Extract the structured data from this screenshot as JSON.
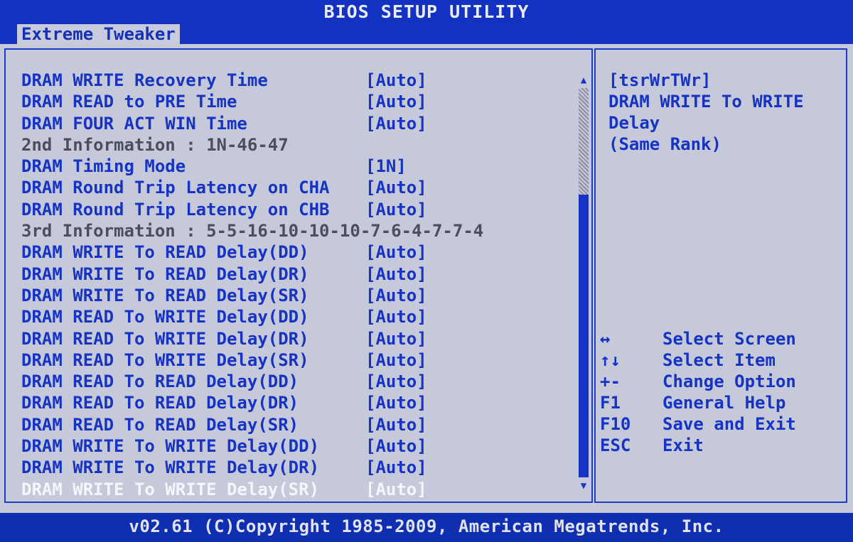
{
  "header": {
    "title": "BIOS SETUP UTILITY"
  },
  "menu": {
    "active_tab": "Extreme Tweaker"
  },
  "settings": [
    {
      "label": "DRAM WRITE Recovery Time",
      "value": "[Auto]",
      "kind": "setting"
    },
    {
      "label": "DRAM READ to PRE Time",
      "value": "[Auto]",
      "kind": "setting"
    },
    {
      "label": "DRAM FOUR ACT WIN Time",
      "value": "[Auto]",
      "kind": "setting"
    },
    {
      "label": "2nd Information : 1N-46-47",
      "value": "",
      "kind": "info"
    },
    {
      "label": "DRAM Timing Mode",
      "value": "[1N]",
      "kind": "setting"
    },
    {
      "label": "DRAM Round Trip Latency on CHA",
      "value": "[Auto]",
      "kind": "setting"
    },
    {
      "label": "DRAM Round Trip Latency on CHB",
      "value": "[Auto]",
      "kind": "setting"
    },
    {
      "label": "3rd Information : 5-5-16-10-10-10-7-6-4-7-7-4",
      "value": "",
      "kind": "info"
    },
    {
      "label": "DRAM WRITE To READ Delay(DD)",
      "value": "[Auto]",
      "kind": "setting"
    },
    {
      "label": "DRAM WRITE To READ Delay(DR)",
      "value": "[Auto]",
      "kind": "setting"
    },
    {
      "label": "DRAM WRITE To READ Delay(SR)",
      "value": "[Auto]",
      "kind": "setting"
    },
    {
      "label": "DRAM READ To WRITE Delay(DD)",
      "value": "[Auto]",
      "kind": "setting"
    },
    {
      "label": "DRAM READ To WRITE Delay(DR)",
      "value": "[Auto]",
      "kind": "setting"
    },
    {
      "label": "DRAM READ To WRITE Delay(SR)",
      "value": "[Auto]",
      "kind": "setting"
    },
    {
      "label": "DRAM READ To READ Delay(DD)",
      "value": "[Auto]",
      "kind": "setting"
    },
    {
      "label": "DRAM READ To READ Delay(DR)",
      "value": "[Auto]",
      "kind": "setting"
    },
    {
      "label": "DRAM READ To READ Delay(SR)",
      "value": "[Auto]",
      "kind": "setting"
    },
    {
      "label": "DRAM WRITE To WRITE Delay(DD)",
      "value": "[Auto]",
      "kind": "setting"
    },
    {
      "label": "DRAM WRITE To WRITE Delay(DR)",
      "value": "[Auto]",
      "kind": "setting"
    },
    {
      "label": "DRAM WRITE To WRITE Delay(SR)",
      "value": "[Auto]",
      "kind": "selected"
    }
  ],
  "help": {
    "lines": [
      "[tsrWrTWr]",
      "DRAM WRITE To WRITE",
      "Delay",
      "(Same Rank)"
    ]
  },
  "keys": [
    {
      "key": "↔",
      "desc": "Select Screen"
    },
    {
      "key": "↑↓",
      "desc": "Select Item"
    },
    {
      "key": "+-",
      "desc": "Change Option"
    },
    {
      "key": "F1",
      "desc": "General Help"
    },
    {
      "key": "F10",
      "desc": "Save and Exit"
    },
    {
      "key": "ESC",
      "desc": "Exit"
    }
  ],
  "scrollbar": {
    "up_icon": "▲",
    "down_icon": "▼"
  },
  "footer": {
    "text": "v02.61 (C)Copyright 1985-2009, American Megatrends, Inc."
  },
  "colors": {
    "background": "#0f2fb0",
    "panel": "#c5c9da",
    "setting_text": "#1633c4",
    "selected_text": "#f4f6fb"
  }
}
